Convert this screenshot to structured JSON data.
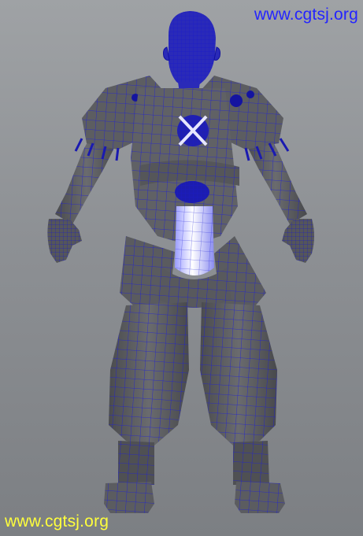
{
  "viewport": {
    "background_top": "#9fa2a5",
    "background_bottom": "#7c7f83",
    "model": {
      "subject": "armored-warrior-model",
      "mesh_fill": "#5f6063",
      "mesh_shadow": "#3e3f42",
      "wire_color": "#1f1fd6",
      "highlight_color": "#eef0ff"
    }
  },
  "watermarks": {
    "top": {
      "text": "www.cgtsj.org",
      "color": "#2424ff"
    },
    "bottom": {
      "text": "www.cgtsj.org",
      "color": "#ffff3c"
    }
  }
}
